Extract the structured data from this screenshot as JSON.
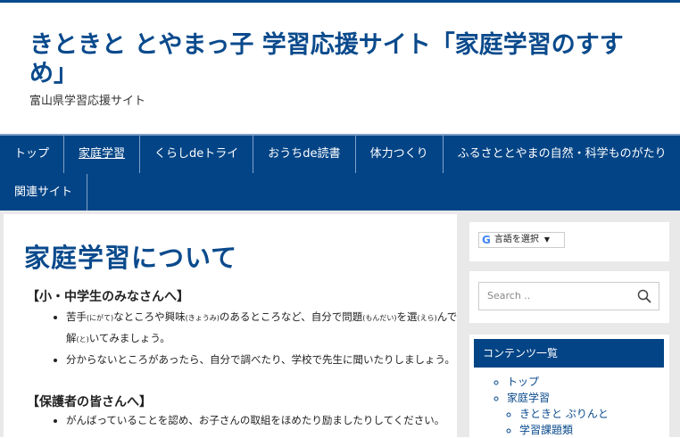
{
  "header": {
    "site_title": "きときと とやまっ子 学習応援サイト「家庭学習のすすめ」",
    "site_description": "富山県学習応援サイト"
  },
  "nav": {
    "row1": [
      {
        "label": "トップ"
      },
      {
        "label": "家庭学習"
      },
      {
        "label": "くらしdeトライ"
      },
      {
        "label": "おうちde読書"
      },
      {
        "label": "体力つくり"
      },
      {
        "label": "ふるさととやまの自然・科学ものがたり"
      }
    ],
    "row2": [
      {
        "label": "関連サイト"
      }
    ]
  },
  "main": {
    "page_title": "家庭学習について",
    "section1_heading": "【小・中学生のみなさんへ】",
    "section1_items": [
      "苦手(にがて)なところや興味(きょうみ)のあるところなど、自分で問題(もんだい)を選(えら)んで解(と)いてみましょう。",
      "分からないところがあったら、自分で調べたり、学校で先生に聞いたりしましょう。"
    ],
    "section2_heading": "【保護者の皆さんへ】",
    "section2_items": [
      "がんばっていることを認め、お子さんの取組をほめたり励ましたりしてください。"
    ]
  },
  "sidebar": {
    "translate_label": "言語を選択",
    "search_placeholder": "Search ..",
    "contents_title": "コンテンツ一覧",
    "contents_items": [
      "トップ",
      "家庭学習"
    ],
    "contents_sub_items": [
      "きときと ぷりんと",
      "学習課題類"
    ]
  },
  "colors": {
    "brand_blue": "#034486",
    "title_blue": "#0a4a8c"
  }
}
